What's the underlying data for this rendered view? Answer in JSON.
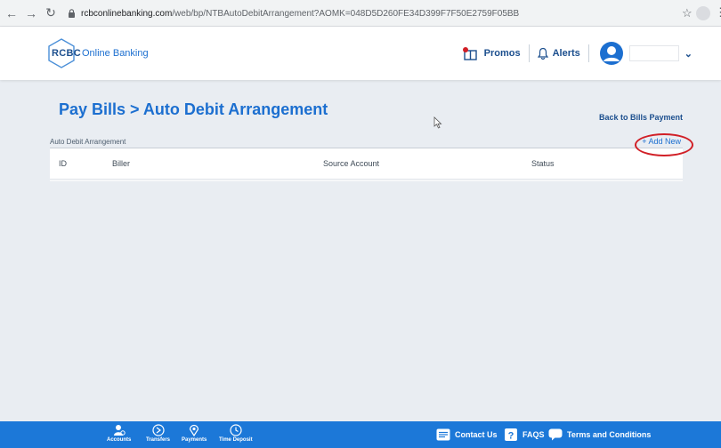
{
  "browser": {
    "url_host": "rcbconlinebanking.com",
    "url_path": "/web/bp/NTBAutoDebitArrangement?AOMK=048D5D260FE34D399F7F50E2759F05BB"
  },
  "header": {
    "logo_text": "RCBC",
    "logo_sub": "Online Banking",
    "promos_label": "Promos",
    "alerts_label": "Alerts"
  },
  "main": {
    "title": "Pay Bills > Auto Debit Arrangement",
    "back_link": "Back to Bills Payment",
    "section_label": "Auto Debit Arrangement",
    "add_new_label": "+ Add New",
    "columns": {
      "id": "ID",
      "biller": "Biller",
      "source": "Source Account",
      "status": "Status"
    }
  },
  "footer": {
    "nav": [
      {
        "label": "Accounts"
      },
      {
        "label": "Transfers"
      },
      {
        "label": "Payments"
      },
      {
        "label": "Time Deposit"
      }
    ],
    "links": {
      "contact": "Contact Us",
      "faqs": "FAQS",
      "terms": "Terms and Conditions"
    }
  },
  "colors": {
    "brand_blue": "#1c6fd0",
    "footer_blue": "#1c78d8",
    "annotation_red": "#d11f26"
  }
}
